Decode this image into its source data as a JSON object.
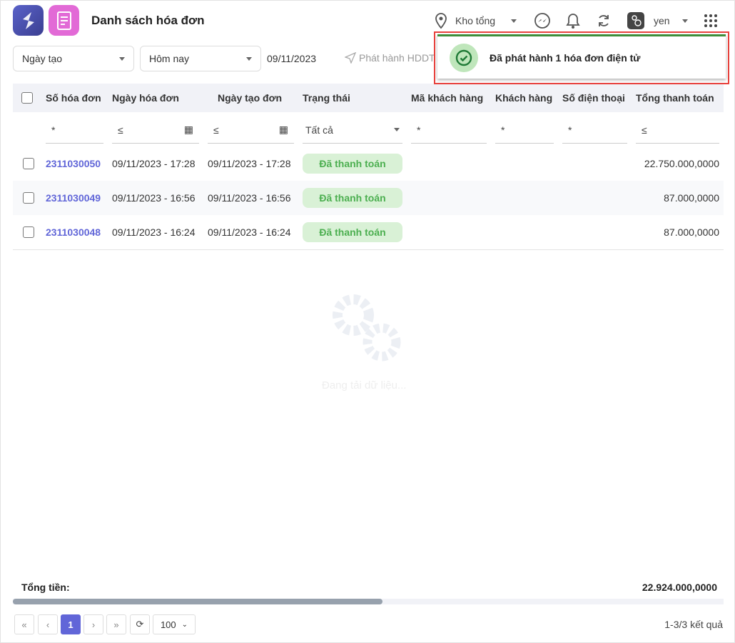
{
  "header": {
    "title": "Danh sách hóa đơn",
    "warehouse": "Kho tổng",
    "user": "yen"
  },
  "filters": {
    "date_type": "Ngày tạo",
    "date_range": "Hôm nay",
    "date_value": "09/11/2023",
    "publish_button": "Phát hành HDDT"
  },
  "toast": {
    "message": "Đã phát hành 1 hóa đơn điện tử"
  },
  "table": {
    "columns": [
      "Số hóa đơn",
      "Ngày hóa đơn",
      "Ngày tạo đơn",
      "Trạng thái",
      "Mã khách hàng",
      "Khách hàng",
      "Số điện thoại",
      "Tổng thanh toán"
    ],
    "filter_row": {
      "invoice": "*",
      "invoice_date": "≤",
      "created_date": "≤",
      "status": "Tất cả",
      "customer_code": "*",
      "customer": "*",
      "phone": "*",
      "total": "≤"
    },
    "rows": [
      {
        "invoice": "2311030050",
        "invoice_date": "09/11/2023 - 17:28",
        "created_date": "09/11/2023 - 17:28",
        "status": "Đã thanh toán",
        "total": "22.750.000,0000"
      },
      {
        "invoice": "2311030049",
        "invoice_date": "09/11/2023 - 16:56",
        "created_date": "09/11/2023 - 16:56",
        "status": "Đã thanh toán",
        "total": "87.000,0000"
      },
      {
        "invoice": "2311030048",
        "invoice_date": "09/11/2023 - 16:24",
        "created_date": "09/11/2023 - 16:24",
        "status": "Đã thanh toán",
        "total": "87.000,0000"
      }
    ],
    "loading_text": "Đang tải dữ liệu...",
    "footer": {
      "label": "Tổng tiền:",
      "total": "22.924.000,0000"
    }
  },
  "pagination": {
    "first": "«",
    "prev": "‹",
    "current": "1",
    "next": "›",
    "last": "»",
    "page_size": "100",
    "summary": "1-3/3 kết quả"
  },
  "scroll_fraction": 0.52
}
